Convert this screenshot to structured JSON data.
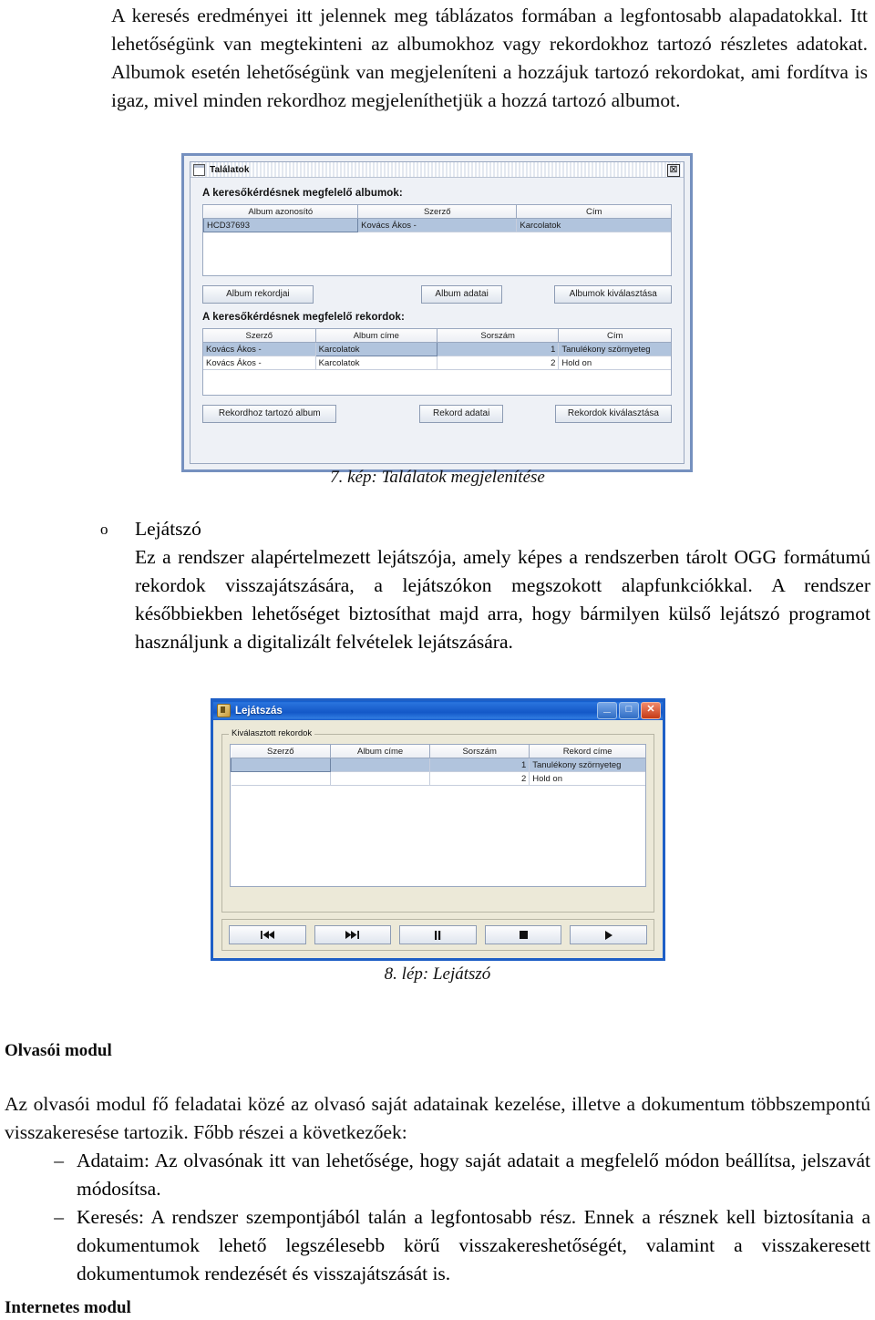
{
  "intro": {
    "paragraph": "A keresés eredményei itt jelennek meg táblázatos formában a legfontosabb alapadatokkal. Itt lehetőségünk van megtekinteni az albumokhoz vagy rekordokhoz tartozó részletes adatokat. Albumok esetén lehetőségünk van megjeleníteni a hozzájuk tartozó rekordokat, ami fordítva is igaz, mivel minden rekordhoz megjeleníthetjük a hozzá tartozó albumot."
  },
  "figure_talalatok": {
    "window_title": "Találatok",
    "close_glyph": "⊠",
    "albums_label": "A keresőkérdésnek megfelelő albumok:",
    "albums_table": {
      "headers": [
        "Album azonosító",
        "Szerző",
        "Cím"
      ],
      "rows": [
        {
          "selected": true,
          "cells": [
            "HCD37693",
            "Kovács Ákos -",
            "Karcolatok"
          ]
        }
      ]
    },
    "album_buttons": [
      "Album rekordjai",
      "Album adatai",
      "Albumok kiválasztása"
    ],
    "records_label": "A keresőkérdésnek megfelelő rekordok:",
    "records_table": {
      "headers": [
        "Szerző",
        "Album címe",
        "Sorszám",
        "Cím"
      ],
      "rows": [
        {
          "selected": true,
          "cells": [
            "Kovács Ákos -",
            "Karcolatok",
            "1",
            "Tanulékony szörnyeteg"
          ]
        },
        {
          "selected": false,
          "cells": [
            "Kovács Ákos -",
            "Karcolatok",
            "2",
            "Hold on"
          ]
        }
      ]
    },
    "record_buttons": [
      "Rekordhoz tartozó album",
      "Rekord adatai",
      "Rekordok kiválasztása"
    ],
    "caption": "7. kép: Találatok megjelenítése"
  },
  "lejatszo": {
    "bullet_mark": "o",
    "title": "Lejátszó",
    "body": "Ez a rendszer alapértelmezett lejátszója, amely képes a rendszerben tárolt OGG formátumú rekordok visszajátszására, a lejátszókon megszokott alapfunkciókkal. A rendszer későbbiekben lehetőséget biztosíthat majd arra, hogy bármilyen külső lejátszó programot használjunk a digitalizált felvételek lejátszására."
  },
  "figure_lejatszas": {
    "window_title": "Lejátszás",
    "window_buttons": [
      {
        "name": "minimize",
        "glyph": "_"
      },
      {
        "name": "maximize",
        "glyph": "□"
      },
      {
        "name": "close",
        "glyph": "✕"
      }
    ],
    "panel_legend": "Kiválasztott rekordok",
    "table": {
      "headers": [
        "Szerző",
        "Album címe",
        "Sorszám",
        "Rekord címe"
      ],
      "rows": [
        {
          "selected": true,
          "cells": [
            "",
            "",
            "1",
            "Tanulékony szörnyeteg"
          ]
        },
        {
          "selected": false,
          "cells": [
            "",
            "",
            "2",
            "Hold on"
          ]
        }
      ]
    },
    "player_buttons": [
      {
        "name": "previous",
        "icon": "skip-back-icon"
      },
      {
        "name": "next",
        "icon": "skip-forward-icon"
      },
      {
        "name": "pause",
        "icon": "pause-icon"
      },
      {
        "name": "stop",
        "icon": "stop-icon"
      },
      {
        "name": "play",
        "icon": "play-icon"
      }
    ],
    "caption": "8. lép: Lejátszó"
  },
  "olvasoi_modul": {
    "heading": "Olvasói modul",
    "intro": "Az olvasói modul fő feladatai közé az olvasó saját adatainak kezelése, illetve a dokumentum többszempontú visszakeresése tartozik. Főbb részei a következőek:",
    "dash": "–",
    "items": [
      "Adataim: Az olvasónak itt van lehetősége, hogy saját adatait a megfelelő módon beállítsa, jelszavát módosítsa.",
      "Keresés: A rendszer szempontjából talán a legfontosabb rész. Ennek a résznek kell biztosítania a dokumentumok lehető legszélesebb körű visszakereshetőségét, valamint a visszakeresett dokumentumok rendezését és visszajátszását is."
    ]
  },
  "internetes_modul": {
    "heading": "Internetes modul"
  },
  "colors": {
    "java_border": "#7590bf",
    "xp_title": "#1e5fc6",
    "table_selection": "#b1c4dd",
    "xp_face": "#ece9d8"
  }
}
